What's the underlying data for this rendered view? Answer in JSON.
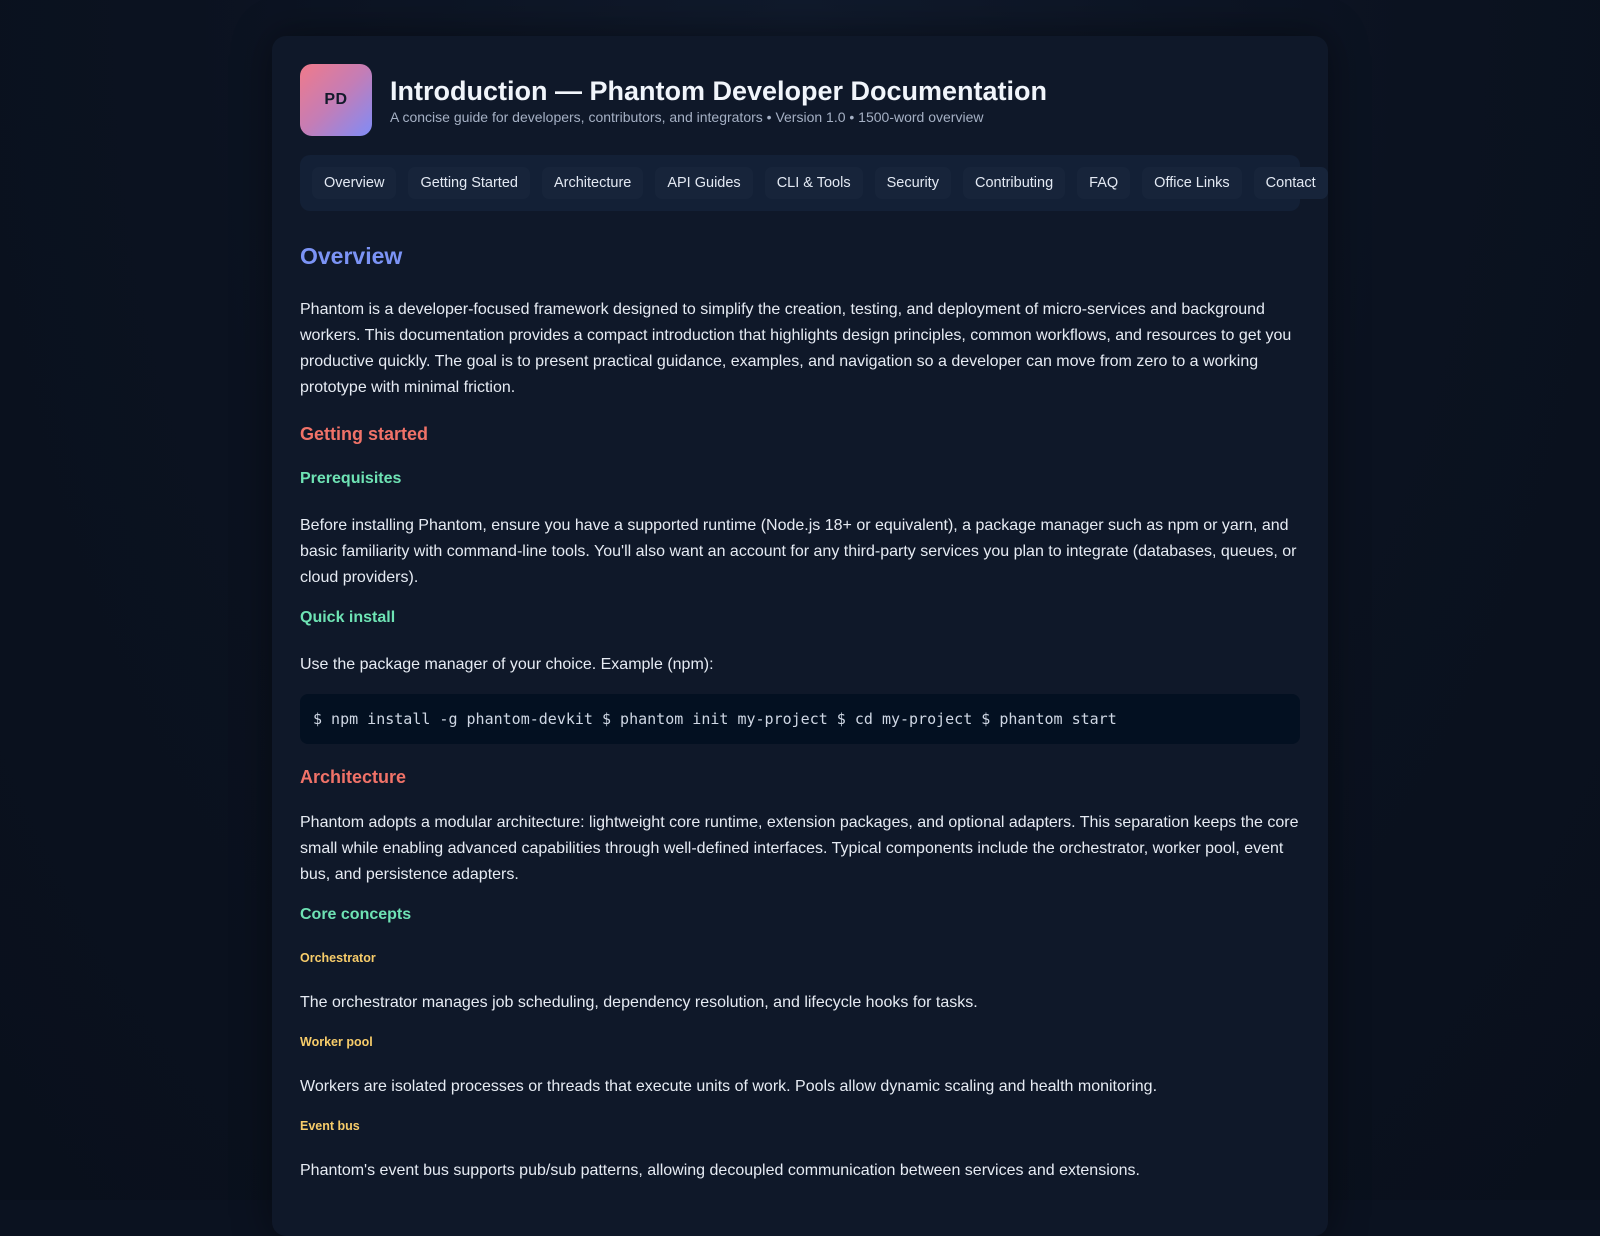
{
  "header": {
    "logo_text": "PD",
    "title": "Introduction — Phantom Developer Documentation",
    "subtitle": "A concise guide for developers, contributors, and integrators • Version 1.0 • 1500-word overview"
  },
  "nav": {
    "items": [
      {
        "label": "Overview"
      },
      {
        "label": "Getting Started"
      },
      {
        "label": "Architecture"
      },
      {
        "label": "API Guides"
      },
      {
        "label": "CLI & Tools"
      },
      {
        "label": "Security"
      },
      {
        "label": "Contributing"
      },
      {
        "label": "FAQ"
      },
      {
        "label": "Office Links"
      },
      {
        "label": "Contact"
      }
    ]
  },
  "overview": {
    "heading": "Overview",
    "body": "Phantom is a developer-focused framework designed to simplify the creation, testing, and deployment of micro-services and background workers. This documentation provides a compact introduction that highlights design principles, common workflows, and resources to get you productive quickly. The goal is to present practical guidance, examples, and navigation so a developer can move from zero to a working prototype with minimal friction."
  },
  "getting_started": {
    "heading": "Getting started",
    "prerequisites": {
      "heading": "Prerequisites",
      "body": "Before installing Phantom, ensure you have a supported runtime (Node.js 18+ or equivalent), a package manager such as npm or yarn, and basic familiarity with command-line tools. You'll also want an account for any third-party services you plan to integrate (databases, queues, or cloud providers)."
    },
    "quick_install": {
      "heading": "Quick install",
      "body": "Use the package manager of your choice. Example (npm):",
      "code": "$ npm install -g phantom-devkit $ phantom init my-project $ cd my-project $ phantom start"
    }
  },
  "architecture": {
    "heading": "Architecture",
    "body": "Phantom adopts a modular architecture: lightweight core runtime, extension packages, and optional adapters. This separation keeps the core small while enabling advanced capabilities through well-defined interfaces. Typical components include the orchestrator, worker pool, event bus, and persistence adapters.",
    "core_concepts": {
      "heading": "Core concepts",
      "orchestrator": {
        "heading": "Orchestrator",
        "body": "The orchestrator manages job scheduling, dependency resolution, and lifecycle hooks for tasks."
      },
      "worker_pool": {
        "heading": "Worker pool",
        "body": "Workers are isolated processes or threads that execute units of work. Pools allow dynamic scaling and health monitoring."
      },
      "event_bus": {
        "heading": "Event bus",
        "body": "Phantom's event bus supports pub/sub patterns, allowing decoupled communication between services and extensions."
      }
    }
  }
}
